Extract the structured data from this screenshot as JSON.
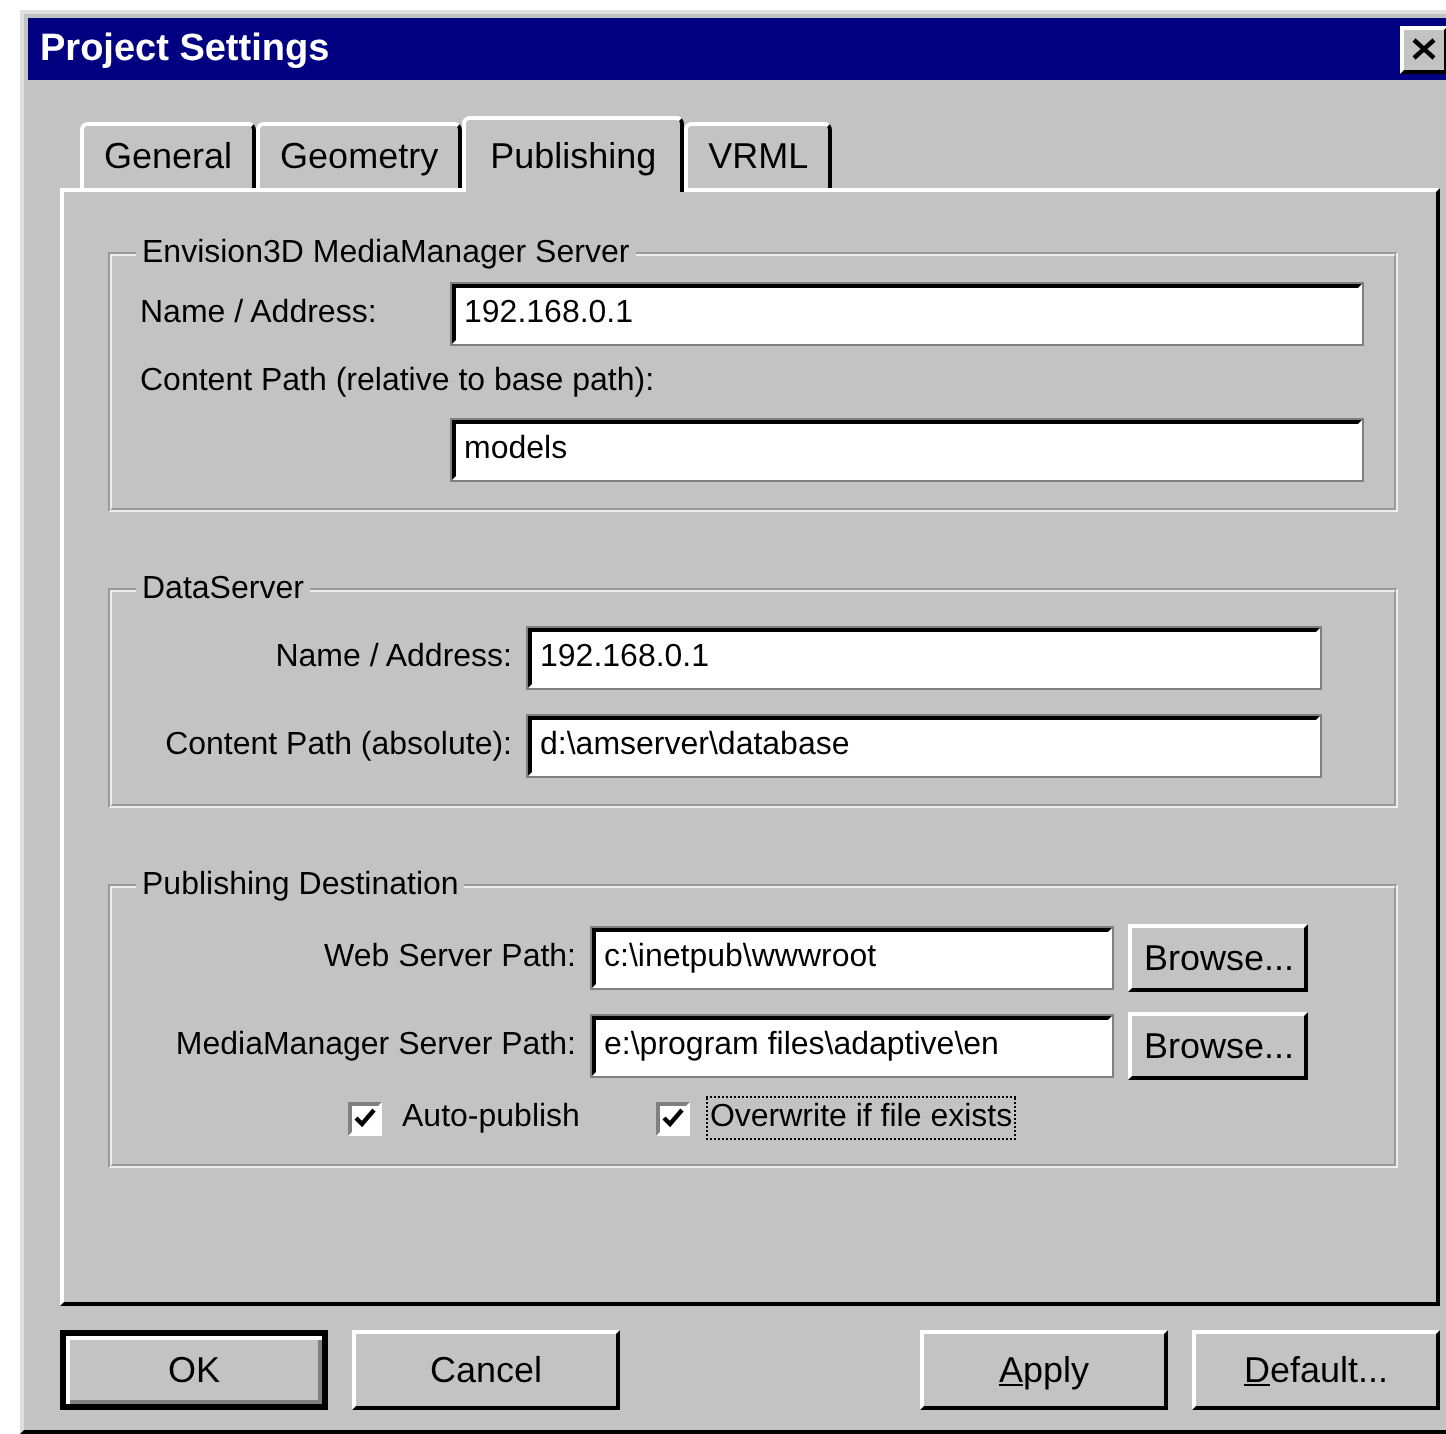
{
  "window": {
    "title": "Project Settings"
  },
  "tabs": [
    {
      "label": "General",
      "selected": false
    },
    {
      "label": "Geometry",
      "selected": false
    },
    {
      "label": "Publishing",
      "selected": true
    },
    {
      "label": "VRML",
      "selected": false
    }
  ],
  "groups": [
    {
      "title": "Envision3D MediaManager Server",
      "kind": "stacked",
      "fields": [
        {
          "label": "Name / Address:",
          "value": "192.168.0.1",
          "kind": "inline"
        },
        {
          "label": "Content Path (relative to base path):",
          "value": "models",
          "kind": "above"
        }
      ]
    },
    {
      "title": "DataServer",
      "kind": "aligned",
      "fields": [
        {
          "label": "Name / Address:",
          "value": "192.168.0.1"
        },
        {
          "label": "Content Path (absolute):",
          "value": "d:\\amserver\\database"
        }
      ]
    },
    {
      "title": "Publishing Destination",
      "kind": "browse",
      "fields": [
        {
          "label": "Web Server Path:",
          "value": "c:\\inetpub\\wwwroot",
          "button": "Browse..."
        },
        {
          "label": "MediaManager Server Path:",
          "value": "e:\\program files\\adaptive\\en",
          "button": "Browse..."
        }
      ],
      "checkboxes": [
        {
          "label": "Auto-publish",
          "checked": true,
          "focused": false
        },
        {
          "label": "Overwrite if file exists",
          "checked": true,
          "focused": true
        }
      ]
    }
  ],
  "left_buttons": [
    {
      "label": "OK",
      "default": true,
      "mnemonic": false
    },
    {
      "label": "Cancel",
      "default": false,
      "mnemonic": false
    }
  ],
  "right_buttons": [
    {
      "label": "Apply",
      "default": false,
      "mnemonic": true
    },
    {
      "label": "Default...",
      "default": false,
      "mnemonic": true
    }
  ]
}
